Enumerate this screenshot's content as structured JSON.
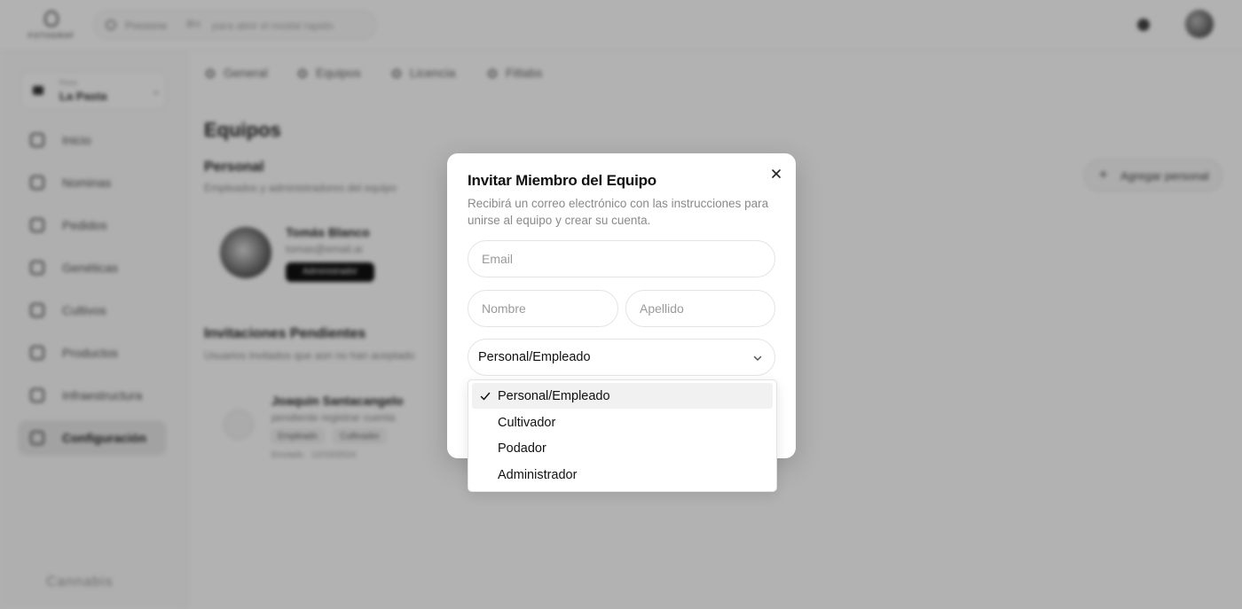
{
  "app": {
    "logo_text": "FOTOGRAF",
    "search": {
      "placeholder": "Presione",
      "kbd": "⌘K",
      "hint": "para abrir el modal rapido"
    },
    "org": {
      "label": "Finca",
      "name": "La Pasta"
    },
    "sidebar": {
      "items": [
        {
          "label": "Inicio"
        },
        {
          "label": "Nominas"
        },
        {
          "label": "Pedidos"
        },
        {
          "label": "Genéticas"
        },
        {
          "label": "Cultivos"
        },
        {
          "label": "Productos"
        },
        {
          "label": "Infraestructura"
        },
        {
          "label": "Configuración"
        }
      ],
      "footer": "Cannabis"
    },
    "tabs": [
      {
        "label": "General"
      },
      {
        "label": "Equipos"
      },
      {
        "label": "Licencia"
      },
      {
        "label": "Fitlabs"
      }
    ],
    "page_title": "Equipos",
    "personal": {
      "title": "Personal",
      "subtitle": "Empleados y administradores del equipo"
    },
    "add_button": "Agregar personal",
    "member": {
      "name": "Tomás Blanco",
      "email": "tomas@email.ai",
      "role_pill": "Administrador"
    },
    "pending": {
      "title": "Invitaciones Pendientes",
      "subtitle": "Usuarios invitados que aún no han aceptado"
    },
    "invite": {
      "name": "Joaquin Santacangelo",
      "text": "pendiente registrar cuenta",
      "badges": [
        "Empleado",
        "Cultivador"
      ],
      "date": "Enviado · 12/10/2024"
    }
  },
  "modal": {
    "title": "Invitar Miembro del Equipo",
    "description": "Recibirá un correo electrónico con las instrucciones para unirse al equipo y crear su cuenta.",
    "email": {
      "value": "",
      "placeholder": "Email"
    },
    "nombre": {
      "value": "",
      "placeholder": "Nombre"
    },
    "apellido": {
      "value": "",
      "placeholder": "Apellido"
    },
    "role_select": {
      "selected": "Personal/Empleado",
      "options": [
        "Personal/Empleado",
        "Cultivador",
        "Podador",
        "Administrador"
      ]
    }
  },
  "icons": {
    "close": "close-icon",
    "chevron": "chevron-down-icon",
    "check": "check-icon"
  },
  "colors": {
    "overlay": "#000000",
    "accent": "#111111",
    "muted_text": "#8a8a8a"
  }
}
